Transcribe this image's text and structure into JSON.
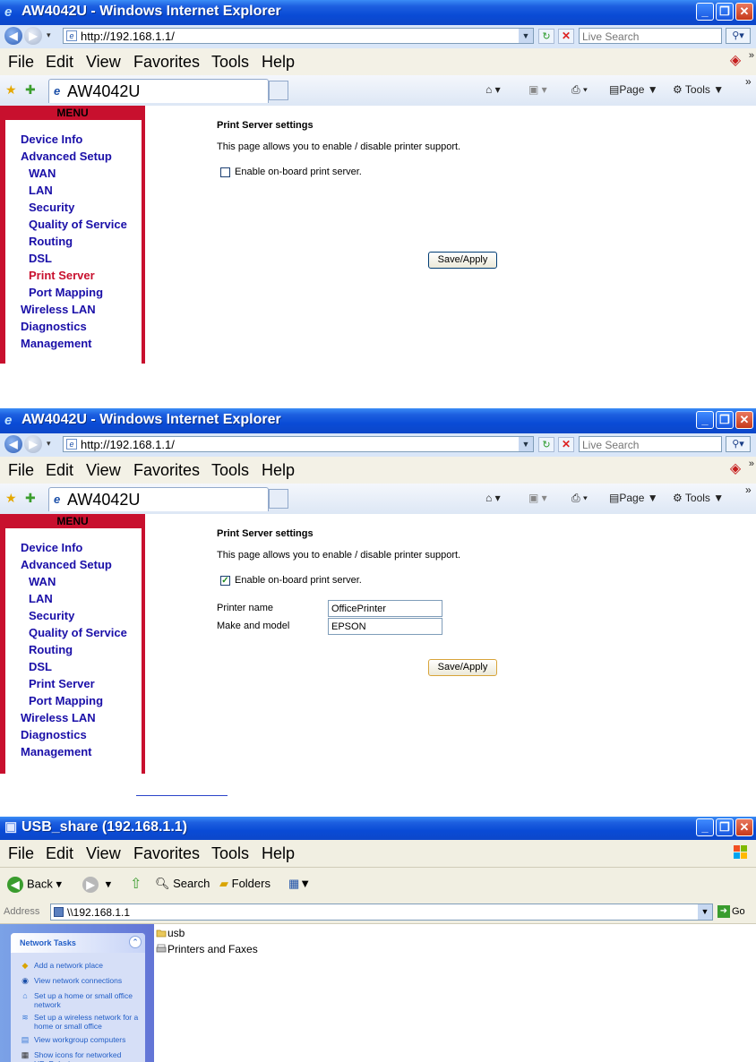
{
  "ie_window": {
    "title": "AW4042U - Windows Internet Explorer",
    "url": "http://192.168.1.1/",
    "search_placeholder": "Live Search",
    "menus": [
      "File",
      "Edit",
      "View",
      "Favorites",
      "Tools",
      "Help"
    ],
    "tab_title": "AW4042U",
    "commands": {
      "page": "Page",
      "tools": "Tools"
    }
  },
  "router_menu": {
    "header": "MENU",
    "items": [
      "Device Info",
      "Advanced Setup",
      "WAN",
      "LAN",
      "Security",
      "Quality of Service",
      "Routing",
      "DSL",
      "Print Server",
      "Port Mapping",
      "Wireless LAN",
      "Diagnostics",
      "Management"
    ]
  },
  "print_server": {
    "title": "Print Server settings",
    "description": "This page allows you to enable / disable printer support.",
    "checkbox_label": "Enable on-board print server.",
    "save_label": "Save/Apply",
    "printer_name_label": "Printer name",
    "printer_name_value": "OfficePrinter",
    "make_model_label": "Make and model",
    "make_model_value": "EPSON"
  },
  "screens": [
    {
      "checkbox_checked": false
    },
    {
      "checkbox_checked": true
    }
  ],
  "explorer": {
    "title": "USB_share (192.168.1.1)",
    "menus": [
      "File",
      "Edit",
      "View",
      "Favorites",
      "Tools",
      "Help"
    ],
    "toolbar": {
      "back": "Back",
      "search": "Search",
      "folders": "Folders"
    },
    "address_label": "Address",
    "address_value": "\\\\192.168.1.1",
    "go_label": "Go",
    "network_tasks_title": "Network Tasks",
    "tasks": [
      "Add a network place",
      "View network connections",
      "Set up a home or small office network",
      "Set up a wireless network for a home or small office",
      "View workgroup computers",
      "Show icons for networked UPnP devices"
    ],
    "items": [
      "usb",
      "Printers and Faxes"
    ]
  }
}
